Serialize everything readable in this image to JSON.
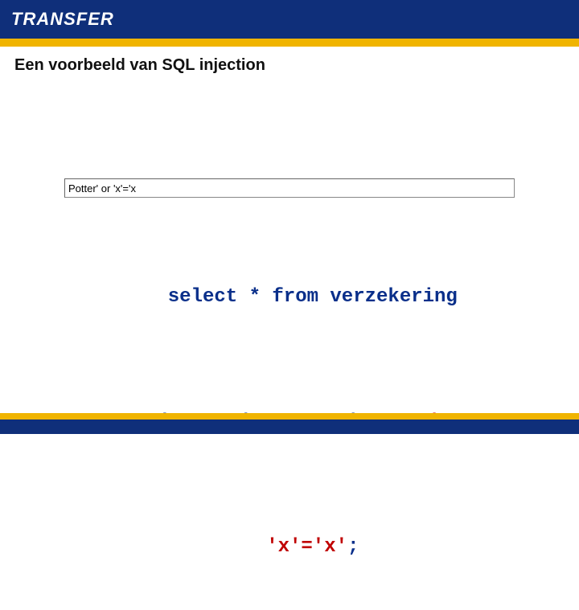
{
  "header": {
    "logo_text": "TRANSFER"
  },
  "slide": {
    "title": "Een voorbeeld van SQL injection"
  },
  "input": {
    "value": "Potter' or 'x'='x"
  },
  "sql": {
    "line1_a": "select * from verzekering",
    "line2_a": "where achternaam='",
    "line2_b": "Potter' or",
    "line3_a": "'x'='x'",
    "line3_b": ";"
  }
}
